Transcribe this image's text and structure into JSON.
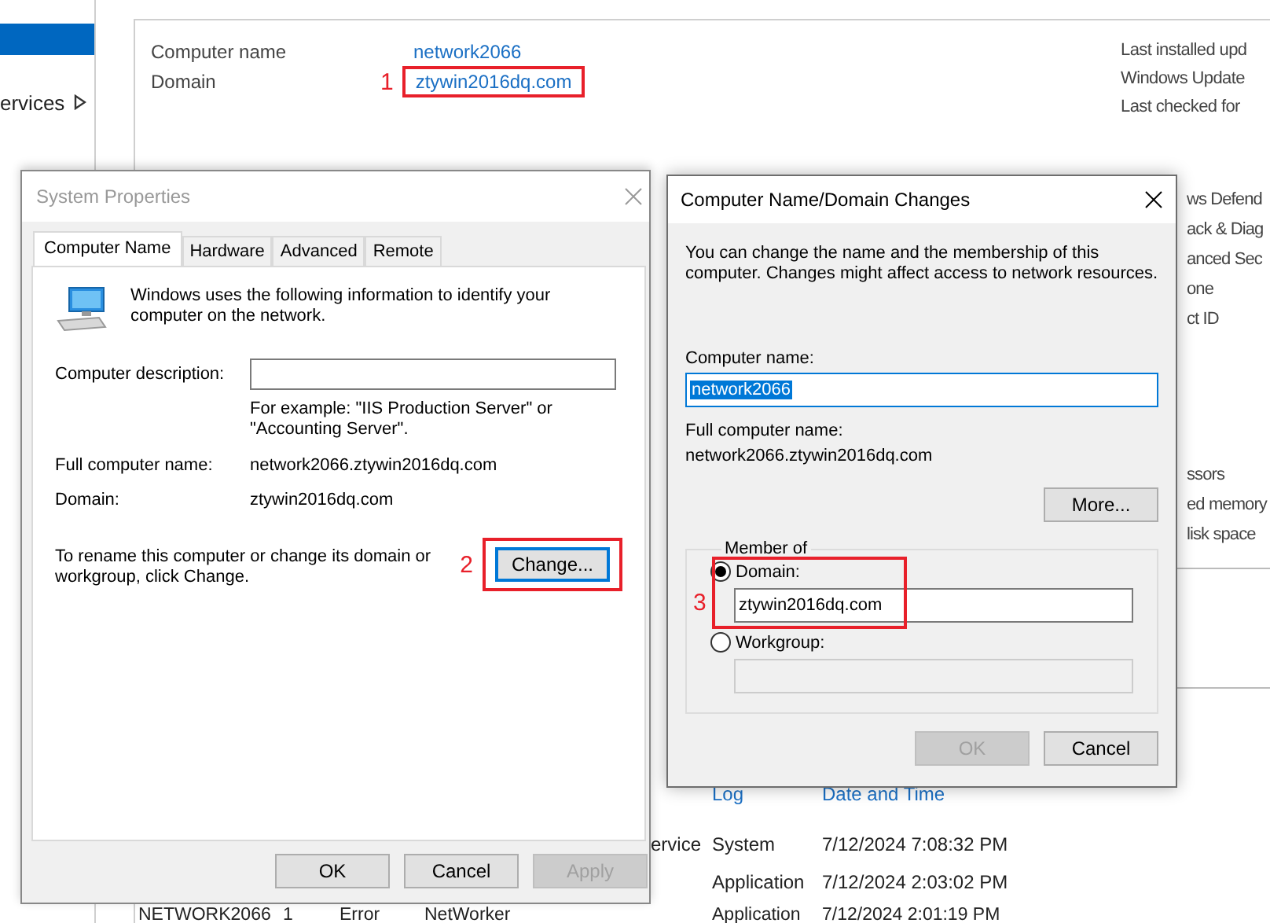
{
  "background": {
    "nav": {
      "items": [
        {
          "selected": true
        },
        {
          "label": "ervices",
          "selected": false,
          "expandable": true
        }
      ]
    },
    "properties": [
      {
        "label": "Computer name",
        "value": "network2066"
      },
      {
        "label": "Domain",
        "value": "ztywin2016dq.com",
        "annotation": "1"
      }
    ],
    "right_column": [
      "Last installed upd",
      "Windows Update",
      "Last checked for"
    ],
    "side_labels": [
      "ws Defend",
      "ack & Diag",
      "anced Sec",
      "one",
      "ct ID"
    ],
    "side_labels_2": [
      "ssors",
      "ed memory",
      "lisk space"
    ],
    "events": {
      "columns": [
        "Log",
        "Date and Time"
      ],
      "rows": [
        {
          "column_4": "ervice",
          "log": "System",
          "time": "7/12/2024 7:08:32 PM"
        },
        {
          "log": "Application",
          "time": "7/12/2024 2:03:02 PM"
        },
        {
          "column_1": "NETWORK2066",
          "column_2": "1",
          "column_3": "Error",
          "column_4": "NetWorker",
          "log": "Application",
          "time": "7/12/2024 2:01:19 PM"
        }
      ]
    }
  },
  "system_properties": {
    "title": "System Properties",
    "active": false,
    "tabs": [
      {
        "label": "Computer Name",
        "selected": true
      },
      {
        "label": "Hardware",
        "selected": false
      },
      {
        "label": "Advanced",
        "selected": false
      },
      {
        "label": "Remote",
        "selected": false
      }
    ],
    "intro": "Windows uses the following information to identify your computer on the network.",
    "description": {
      "label": "Computer description:"
    },
    "example": "For example: \"IIS Production Server\" or \"Accounting Server\".",
    "fields": [
      {
        "label": "Full computer name:",
        "value": "network2066.ztywin2016dq.com"
      },
      {
        "label": "Domain:",
        "value": "ztywin2016dq.com"
      }
    ],
    "rename_text": "To rename this computer or change its domain or workgroup, click Change.",
    "change_button": {
      "label": "Change...",
      "focused": true,
      "annotation": "2"
    },
    "buttons": [
      {
        "label": "OK",
        "disabled": false
      },
      {
        "label": "Cancel",
        "disabled": false
      },
      {
        "label": "Apply",
        "disabled": true
      }
    ]
  },
  "domain_changes": {
    "title": "Computer Name/Domain Changes",
    "active": true,
    "intro": "You can change the name and the membership of this computer. Changes might affect access to network resources.",
    "computer_name": {
      "label": "Computer name:",
      "value": "network2066",
      "text_selected": true
    },
    "full_name": {
      "label": "Full computer name:",
      "value": "network2066.ztywin2016dq.com"
    },
    "more_button": "More...",
    "member_of": {
      "title": "Member of",
      "options": [
        {
          "label": "Domain:",
          "selected": true,
          "value": "ztywin2016dq.com",
          "disabled": false,
          "annotation": "3"
        },
        {
          "label": "Workgroup:",
          "selected": false,
          "disabled": true
        }
      ]
    },
    "buttons": [
      {
        "label": "OK",
        "disabled": true
      },
      {
        "label": "Cancel",
        "disabled": false
      }
    ]
  }
}
